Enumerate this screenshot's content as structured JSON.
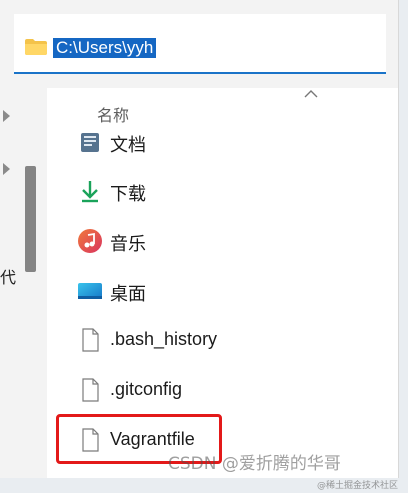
{
  "address_bar": {
    "path": "C:\\Users\\yyh"
  },
  "left_pane": {
    "partial_text": "代"
  },
  "file_list": {
    "column_header": "名称",
    "items": [
      {
        "name": "文档",
        "icon": "documents-icon"
      },
      {
        "name": "下载",
        "icon": "download-icon"
      },
      {
        "name": "音乐",
        "icon": "music-icon"
      },
      {
        "name": "桌面",
        "icon": "desktop-icon"
      },
      {
        "name": ".bash_history",
        "icon": "file-icon"
      },
      {
        "name": ".gitconfig",
        "icon": "file-icon"
      },
      {
        "name": "Vagrantfile",
        "icon": "file-icon"
      }
    ]
  },
  "highlight_color": "#e31919",
  "watermark": {
    "main": "CSDN @爱折腾的华哥",
    "small": "@稀土掘金技术社区"
  }
}
